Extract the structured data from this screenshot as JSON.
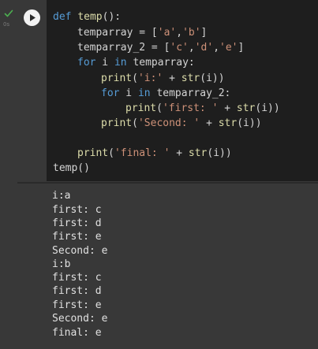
{
  "status": {
    "icon": "check-icon",
    "time": "0s",
    "color": "#4caf50"
  },
  "run_button": {
    "icon": "play-icon"
  },
  "code": {
    "l1": {
      "kw": "def",
      "fn": "temp",
      "rest": "():"
    },
    "l2": {
      "a": "temparray = [",
      "s1": "'a'",
      "b": ",",
      "s2": "'b'",
      "c": "]"
    },
    "l3": {
      "a": "temparray_2 = [",
      "s1": "'c'",
      "b": ",",
      "s2": "'d'",
      "c": ",",
      "s3": "'e'",
      "d": "]"
    },
    "l4": {
      "kw1": "for",
      "a": " i ",
      "kw2": "in",
      "b": " temparray:"
    },
    "l5": {
      "fn": "print",
      "a": "(",
      "s": "'i:'",
      "b": " + ",
      "fn2": "str",
      "c": "(i))"
    },
    "l6": {
      "kw1": "for",
      "a": " i ",
      "kw2": "in",
      "b": " temparray_2:"
    },
    "l7": {
      "fn": "print",
      "a": "(",
      "s": "'first: '",
      "b": " + ",
      "fn2": "str",
      "c": "(i))"
    },
    "l8": {
      "fn": "print",
      "a": "(",
      "s": "'Second: '",
      "b": " + ",
      "fn2": "str",
      "c": "(i))"
    },
    "l10": {
      "fn": "print",
      "a": "(",
      "s": "'final: '",
      "b": " + ",
      "fn2": "str",
      "c": "(i))"
    },
    "l11": {
      "a": "temp()"
    }
  },
  "output": [
    "i:a",
    "first: c",
    "first: d",
    "first: e",
    "Second: e",
    "i:b",
    "first: c",
    "first: d",
    "first: e",
    "Second: e",
    "final: e"
  ]
}
